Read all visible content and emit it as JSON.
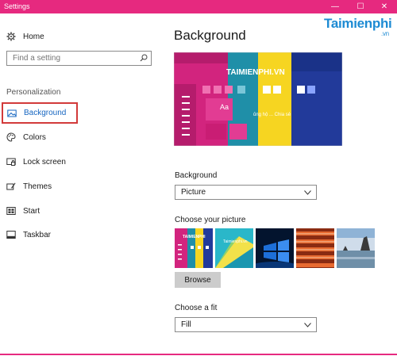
{
  "window": {
    "title": "Settings",
    "minimize": "—",
    "maximize": "☐",
    "close": "✕"
  },
  "watermark": {
    "brand": "Taimienphi",
    "suffix": ".vn"
  },
  "sidebar": {
    "home": "Home",
    "search_placeholder": "Find a setting",
    "section": "Personalization",
    "items": [
      {
        "label": "Background",
        "icon": "image-icon",
        "selected": true
      },
      {
        "label": "Colors",
        "icon": "palette-icon"
      },
      {
        "label": "Lock screen",
        "icon": "lock-screen-icon"
      },
      {
        "label": "Themes",
        "icon": "themes-icon"
      },
      {
        "label": "Start",
        "icon": "start-icon"
      },
      {
        "label": "Taskbar",
        "icon": "taskbar-icon"
      }
    ]
  },
  "main": {
    "title": "Background",
    "preview": {
      "brand_text": "TAIMIENPHI.VN",
      "tagline": "ủng hộ ... Chia sẻ",
      "sample_tile": "Aa"
    },
    "background_label": "Background",
    "background_value": "Picture",
    "choose_picture_label": "Choose your picture",
    "thumb1_text": "TAIMIENPHI",
    "thumb2_text": "Taimienphi.vn",
    "browse": "Browse",
    "fit_label": "Choose a fit",
    "fit_value": "Fill"
  },
  "colors": {
    "accent": "#e6297f",
    "selection_border": "#d23a3a",
    "link": "#1565c0"
  }
}
